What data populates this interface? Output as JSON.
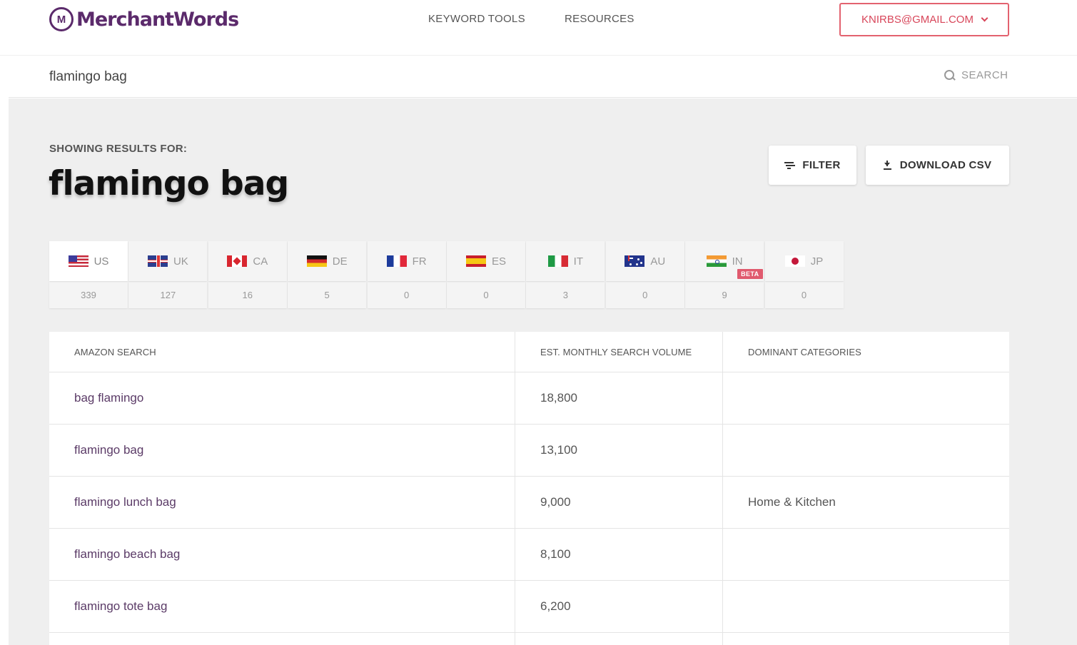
{
  "header": {
    "logo_text": "MerchantWords",
    "logo_mark": "M",
    "nav": [
      {
        "label": "KEYWORD TOOLS"
      },
      {
        "label": "RESOURCES"
      }
    ],
    "account_label": "KNIRBS@GMAIL.COM"
  },
  "search": {
    "value": "flamingo bag",
    "button_label": "SEARCH",
    "icon": "search-icon"
  },
  "results": {
    "showing_label": "SHOWING RESULTS FOR:",
    "query": "flamingo bag",
    "filter_label": "FILTER",
    "download_label": "DOWNLOAD CSV"
  },
  "countries": [
    {
      "code": "US",
      "count": "339",
      "flag": "f-us",
      "active": true
    },
    {
      "code": "UK",
      "count": "127",
      "flag": "f-uk"
    },
    {
      "code": "CA",
      "count": "16",
      "flag": "f-ca"
    },
    {
      "code": "DE",
      "count": "5",
      "flag": "f-de"
    },
    {
      "code": "FR",
      "count": "0",
      "flag": "f-fr"
    },
    {
      "code": "ES",
      "count": "0",
      "flag": "f-es"
    },
    {
      "code": "IT",
      "count": "3",
      "flag": "f-it"
    },
    {
      "code": "AU",
      "count": "0",
      "flag": "f-au"
    },
    {
      "code": "IN",
      "count": "9",
      "flag": "f-in",
      "badge": "BETA"
    },
    {
      "code": "JP",
      "count": "0",
      "flag": "f-jp"
    }
  ],
  "table": {
    "columns": [
      "AMAZON SEARCH",
      "EST. MONTHLY SEARCH VOLUME",
      "DOMINANT CATEGORIES"
    ],
    "rows": [
      {
        "search": "bag flamingo",
        "volume": "18,800",
        "category": ""
      },
      {
        "search": "flamingo bag",
        "volume": "13,100",
        "category": ""
      },
      {
        "search": "flamingo lunch bag",
        "volume": "9,000",
        "category": "Home & Kitchen"
      },
      {
        "search": "flamingo beach bag",
        "volume": "8,100",
        "category": ""
      },
      {
        "search": "flamingo tote bag",
        "volume": "6,200",
        "category": ""
      }
    ]
  },
  "colors": {
    "brand": "#5b2a6b",
    "accent": "#d8465a",
    "background": "#efefef"
  }
}
